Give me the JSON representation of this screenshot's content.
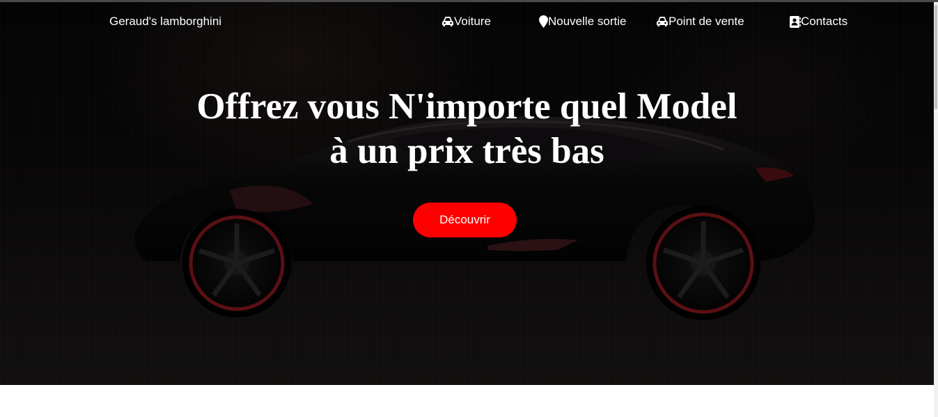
{
  "header": {
    "brand": "Geraud's lamborghini",
    "nav": [
      {
        "label": "Voiture",
        "icon": "car-icon"
      },
      {
        "label": "Nouvelle sortie",
        "icon": "map-pin-icon"
      },
      {
        "label": "Point de vente",
        "icon": "car-icon"
      },
      {
        "label": "Contacts",
        "icon": "address-book-icon"
      }
    ]
  },
  "hero": {
    "title_line1": "Offrez vous N'importe quel Model",
    "title_line2": "à un prix très bas",
    "cta_label": "Découvrir",
    "background_image": "dark sports car"
  },
  "colors": {
    "accent": "#ff0000",
    "hero_bg": "#0a0909",
    "text": "#ffffff"
  }
}
